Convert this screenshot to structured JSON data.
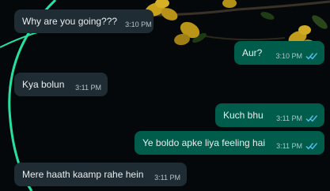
{
  "messages": [
    {
      "direction": "incoming",
      "text": "Why are you going???",
      "time": "3:10 PM",
      "read": false
    },
    {
      "direction": "outgoing",
      "text": "Aur?",
      "time": "3:10 PM",
      "read": true
    },
    {
      "direction": "incoming",
      "text": "Kya bolun",
      "time": "3:11 PM",
      "read": false
    },
    {
      "direction": "outgoing",
      "text": "Kuch bhu",
      "time": "3:11 PM",
      "read": true
    },
    {
      "direction": "outgoing",
      "text": "Ye boldo apke liya feeling hai",
      "time": "3:11 PM",
      "read": true
    },
    {
      "direction": "incoming",
      "text": "Mere haath kaamp rahe hein",
      "time": "3:11 PM",
      "read": false
    }
  ],
  "colors": {
    "background": "#05080a",
    "incoming_bubble": "#1f2c33",
    "outgoing_bubble": "#005c4b",
    "read_ticks": "#53bdeb",
    "frame_accent": "#27e0a0"
  },
  "icons": [
    "double-check-read-icon"
  ]
}
